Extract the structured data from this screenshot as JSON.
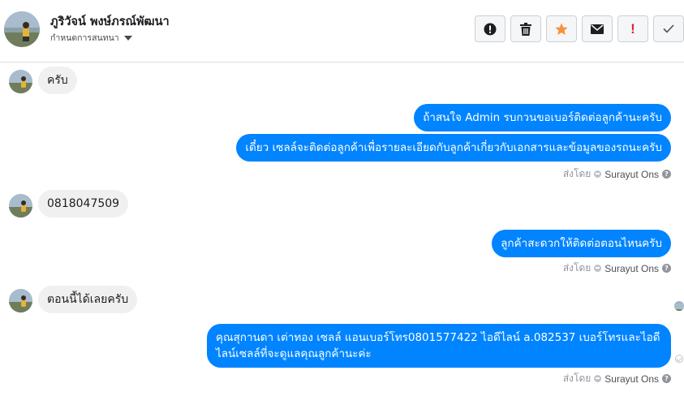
{
  "header": {
    "name": "ภูริวัจน์ พงษ์ภรณ์พัฒนา",
    "subtitle": "กำหนดการสนทนา"
  },
  "toolbar": {
    "buttons": [
      {
        "icon": "info-icon"
      },
      {
        "icon": "trash-icon"
      },
      {
        "icon": "star-icon",
        "color": "#f7923b"
      },
      {
        "icon": "mail-icon"
      },
      {
        "icon": "important-icon",
        "label": "!",
        "color": "#e41e3f"
      },
      {
        "icon": "check-icon"
      }
    ]
  },
  "messages": [
    {
      "direction": "in",
      "text": "ครับ"
    },
    {
      "direction": "out",
      "text": "ถ้าสนใจ Admin รบกวนขอเบอร์ติดต่อลูกค้านะครับ"
    },
    {
      "direction": "out",
      "text": "เดี๋ยว เซลล์จะติดต่อลูกค้าเพื่อรายละเอียดกับลูกค้าเกี่ยวกับเอกสารและข้อมูลของรถนะครับ"
    },
    {
      "direction": "in",
      "text": "0818047509"
    },
    {
      "direction": "out",
      "text": "ลูกค้าสะดวกให้ติดต่อตอนไหนครับ"
    },
    {
      "direction": "in",
      "text": "ตอนนี้ได้เลยครับ"
    },
    {
      "direction": "out",
      "text": "คุณสุกานดา เต่าทอง  เซลล์ แอนเบอร์โทร0801577422 ไอดีไลน์ a.082537  เบอร์โทรและไอดีไลน์เซลล์ที่จะดูแลคุณลูกค้านะค่ะ"
    }
  ],
  "sent_by": {
    "prefix": "ส่งโดย",
    "sender": "Surayut Ons"
  },
  "colors": {
    "outgoing_bubble": "#0084ff",
    "incoming_bubble": "#f1f0f0",
    "star": "#f7923b",
    "important": "#e41e3f"
  }
}
